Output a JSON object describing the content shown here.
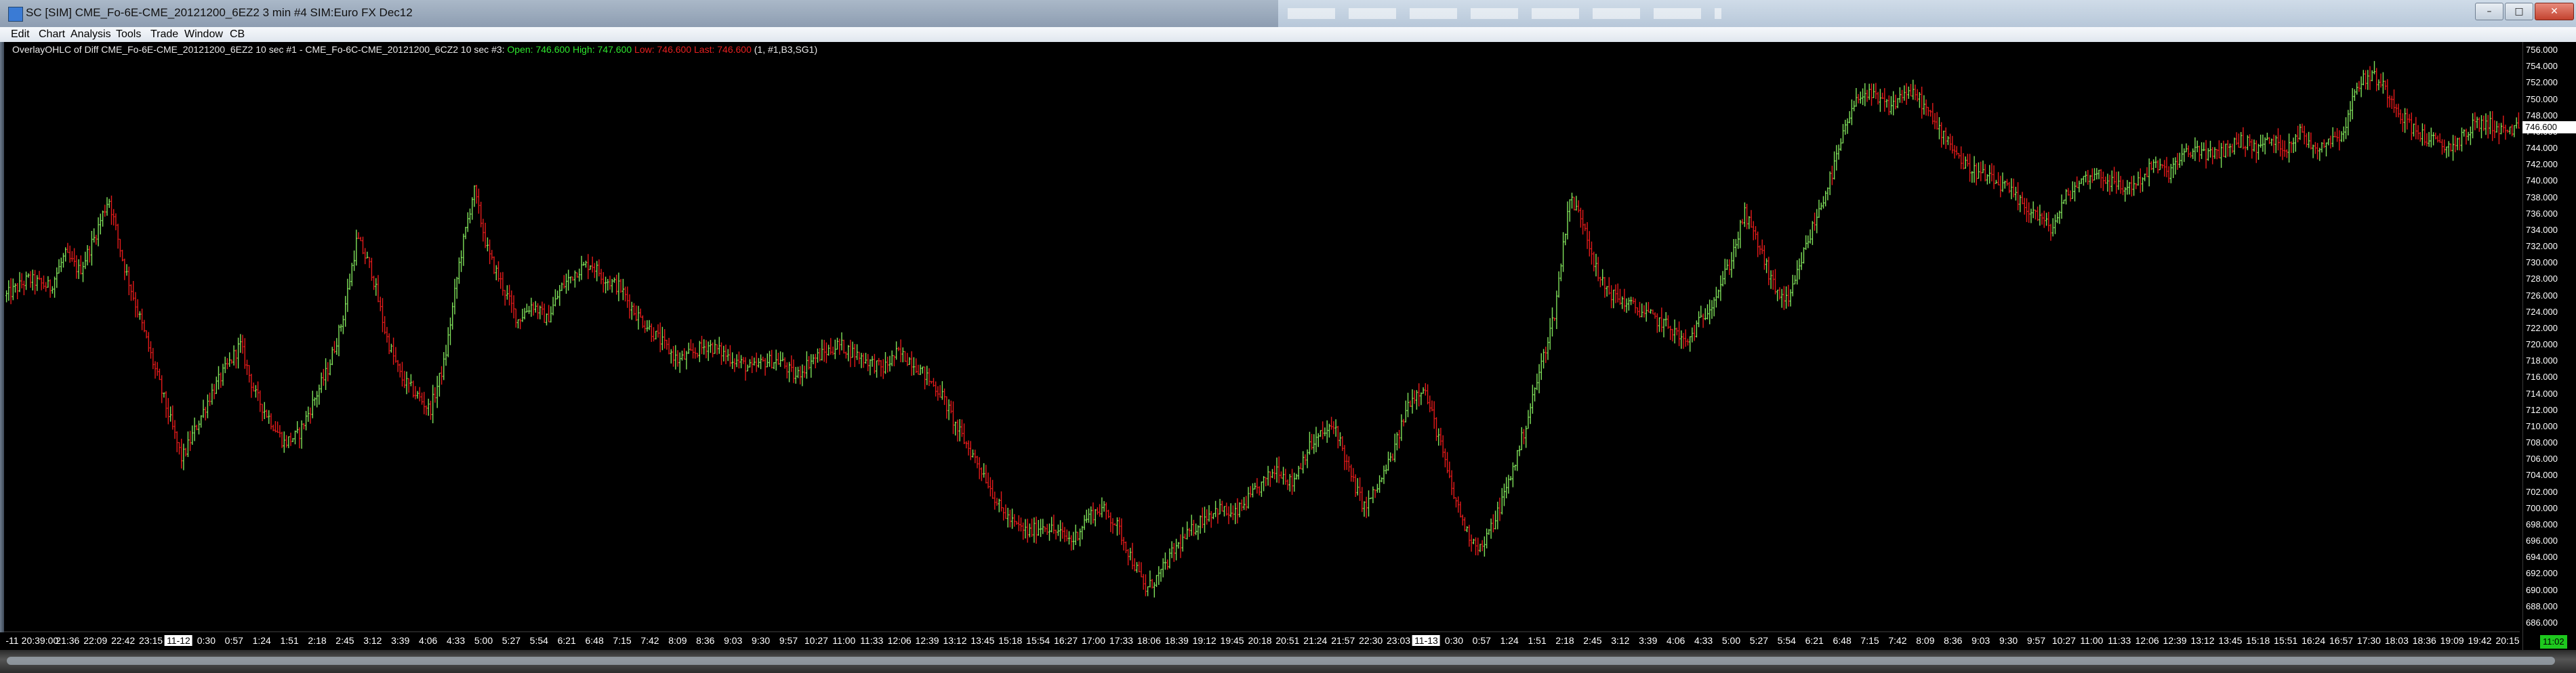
{
  "window": {
    "title": "SC [SIM] CME_Fo-6E-CME_20121200_6EZ2  3 min  #4  SIM:Euro FX Dec12",
    "controls": [
      "–",
      "□",
      "✕"
    ]
  },
  "menu": [
    "Edit",
    "Chart",
    "Analysis",
    "Tools",
    "Trade",
    "Window",
    "CB"
  ],
  "study_header": {
    "name": "OverlayOHLC of Diff CME_Fo-6E-CME_20121200_6EZ2  10 sec  #1 - CME_Fo-6C-CME_20121200_6CZ2  10 sec  #3:",
    "open_label": "Open:",
    "open_value": "746.600",
    "high_label": "High:",
    "high_value": "747.600",
    "low_label": "Low:",
    "low_value": "746.600",
    "last_label": "Last:",
    "last_value": "746.600",
    "suffix": "(1, #1,B3,SG1)"
  },
  "current_price_marker": "746.600",
  "time_badge": "11:02",
  "colors": {
    "background": "#000000",
    "up_bar": "#7fe05a",
    "down_bar": "#e31a1a",
    "axis_text": "#ffffff"
  },
  "chart_data": {
    "type": "ohlc",
    "ylim": [
      685.0,
      757.0
    ],
    "y_ticks": [
      "756.000",
      "754.000",
      "752.000",
      "750.000",
      "748.000",
      "746.000",
      "744.000",
      "742.000",
      "740.000",
      "738.000",
      "736.000",
      "734.000",
      "732.000",
      "730.000",
      "728.000",
      "726.000",
      "724.000",
      "722.000",
      "720.000",
      "718.000",
      "716.000",
      "714.000",
      "712.000",
      "710.000",
      "708.000",
      "706.000",
      "704.000",
      "702.000",
      "700.000",
      "698.000",
      "696.000",
      "694.000",
      "692.000",
      "690.000",
      "688.000",
      "686.000"
    ],
    "x_ticks": [
      "-11",
      "20:39:00",
      "21:36",
      "22:09",
      "22:42",
      "23:15",
      "11-12",
      "0:30",
      "0:57",
      "1:24",
      "1:51",
      "2:18",
      "2:45",
      "3:12",
      "3:39",
      "4:06",
      "4:33",
      "5:00",
      "5:27",
      "5:54",
      "6:21",
      "6:48",
      "7:15",
      "7:42",
      "8:09",
      "8:36",
      "9:03",
      "9:30",
      "9:57",
      "10:27",
      "11:00",
      "11:33",
      "12:06",
      "12:39",
      "13:12",
      "13:45",
      "15:18",
      "15:54",
      "16:27",
      "17:00",
      "17:33",
      "18:06",
      "18:39",
      "19:12",
      "19:45",
      "20:18",
      "20:51",
      "21:24",
      "21:57",
      "22:30",
      "23:03",
      "11-13",
      "0:30",
      "0:57",
      "1:24",
      "1:51",
      "2:18",
      "2:45",
      "3:12",
      "3:39",
      "4:06",
      "4:33",
      "5:00",
      "5:27",
      "5:54",
      "6:21",
      "6:48",
      "7:15",
      "7:42",
      "8:09",
      "8:36",
      "9:03",
      "9:30",
      "9:57",
      "10:27",
      "11:00",
      "11:33",
      "12:06",
      "12:39",
      "13:12",
      "13:45",
      "15:18",
      "15:51",
      "16:24",
      "16:57",
      "17:30",
      "18:03",
      "18:36",
      "19:09",
      "19:42",
      "20:15"
    ],
    "date_ticks": [
      "11-12",
      "11-13"
    ],
    "close_path": [
      [
        0,
        726
      ],
      [
        3,
        728
      ],
      [
        6,
        727
      ],
      [
        8,
        731
      ],
      [
        10,
        729
      ],
      [
        12,
        733
      ],
      [
        14,
        738
      ],
      [
        16,
        730
      ],
      [
        18,
        724
      ],
      [
        20,
        718
      ],
      [
        22,
        712
      ],
      [
        24,
        706
      ],
      [
        26,
        710
      ],
      [
        28,
        714
      ],
      [
        30,
        717
      ],
      [
        32,
        720
      ],
      [
        34,
        714
      ],
      [
        36,
        711
      ],
      [
        38,
        708
      ],
      [
        40,
        709
      ],
      [
        42,
        713
      ],
      [
        44,
        717
      ],
      [
        46,
        723
      ],
      [
        48,
        733
      ],
      [
        50,
        729
      ],
      [
        52,
        721
      ],
      [
        54,
        716
      ],
      [
        56,
        714
      ],
      [
        58,
        712
      ],
      [
        60,
        718
      ],
      [
        62,
        730
      ],
      [
        64,
        739
      ],
      [
        66,
        731
      ],
      [
        68,
        727
      ],
      [
        70,
        723
      ],
      [
        72,
        725
      ],
      [
        74,
        723
      ],
      [
        76,
        727
      ],
      [
        78,
        729
      ],
      [
        80,
        730
      ],
      [
        82,
        728
      ],
      [
        84,
        727
      ],
      [
        86,
        724
      ],
      [
        88,
        722
      ],
      [
        90,
        720
      ],
      [
        92,
        718
      ],
      [
        94,
        719
      ],
      [
        96,
        720
      ],
      [
        98,
        719
      ],
      [
        100,
        718
      ],
      [
        102,
        717
      ],
      [
        104,
        718
      ],
      [
        106,
        718
      ],
      [
        108,
        716
      ],
      [
        110,
        718
      ],
      [
        112,
        719
      ],
      [
        114,
        720
      ],
      [
        116,
        719
      ],
      [
        118,
        718
      ],
      [
        120,
        717
      ],
      [
        122,
        719
      ],
      [
        124,
        718
      ],
      [
        126,
        716
      ],
      [
        128,
        714
      ],
      [
        130,
        710
      ],
      [
        132,
        707
      ],
      [
        134,
        704
      ],
      [
        136,
        700
      ],
      [
        138,
        698
      ],
      [
        140,
        697
      ],
      [
        142,
        698
      ],
      [
        144,
        697
      ],
      [
        146,
        696
      ],
      [
        148,
        699
      ],
      [
        150,
        700
      ],
      [
        152,
        698
      ],
      [
        154,
        694
      ],
      [
        156,
        690
      ],
      [
        158,
        692
      ],
      [
        160,
        695
      ],
      [
        162,
        697
      ],
      [
        164,
        699
      ],
      [
        166,
        700
      ],
      [
        168,
        699
      ],
      [
        170,
        701
      ],
      [
        172,
        703
      ],
      [
        174,
        705
      ],
      [
        176,
        703
      ],
      [
        178,
        707
      ],
      [
        180,
        709
      ],
      [
        182,
        710
      ],
      [
        184,
        704
      ],
      [
        186,
        700
      ],
      [
        188,
        703
      ],
      [
        190,
        707
      ],
      [
        192,
        713
      ],
      [
        194,
        715
      ],
      [
        196,
        709
      ],
      [
        198,
        702
      ],
      [
        200,
        697
      ],
      [
        202,
        695
      ],
      [
        204,
        699
      ],
      [
        206,
        704
      ],
      [
        208,
        710
      ],
      [
        210,
        717
      ],
      [
        212,
        724
      ],
      [
        214,
        738
      ],
      [
        216,
        735
      ],
      [
        218,
        728
      ],
      [
        220,
        726
      ],
      [
        222,
        725
      ],
      [
        224,
        724
      ],
      [
        226,
        723
      ],
      [
        228,
        722
      ],
      [
        230,
        720
      ],
      [
        232,
        723
      ],
      [
        234,
        726
      ],
      [
        236,
        730
      ],
      [
        238,
        736
      ],
      [
        240,
        732
      ],
      [
        242,
        727
      ],
      [
        244,
        725
      ],
      [
        246,
        731
      ],
      [
        248,
        736
      ],
      [
        250,
        741
      ],
      [
        252,
        747
      ],
      [
        254,
        751
      ],
      [
        256,
        750
      ],
      [
        258,
        749
      ],
      [
        260,
        751
      ],
      [
        262,
        750
      ],
      [
        264,
        747
      ],
      [
        266,
        745
      ],
      [
        268,
        742
      ],
      [
        270,
        741
      ],
      [
        272,
        740
      ],
      [
        274,
        739
      ],
      [
        276,
        737
      ],
      [
        278,
        736
      ],
      [
        280,
        734
      ],
      [
        282,
        738
      ],
      [
        284,
        740
      ],
      [
        286,
        741
      ],
      [
        288,
        740
      ],
      [
        290,
        739
      ],
      [
        292,
        740
      ],
      [
        294,
        742
      ],
      [
        296,
        741
      ],
      [
        298,
        743
      ],
      [
        300,
        744
      ],
      [
        302,
        743
      ],
      [
        304,
        744
      ],
      [
        306,
        745
      ],
      [
        308,
        744
      ],
      [
        310,
        745
      ],
      [
        312,
        744
      ],
      [
        314,
        746
      ],
      [
        316,
        744
      ],
      [
        318,
        745
      ],
      [
        320,
        746
      ],
      [
        322,
        752
      ],
      [
        324,
        753
      ],
      [
        326,
        751
      ],
      [
        328,
        748
      ],
      [
        330,
        746
      ],
      [
        332,
        745
      ],
      [
        334,
        744
      ],
      [
        336,
        745
      ],
      [
        338,
        747
      ],
      [
        340,
        747
      ],
      [
        342,
        746
      ],
      [
        344,
        746.6
      ]
    ]
  }
}
